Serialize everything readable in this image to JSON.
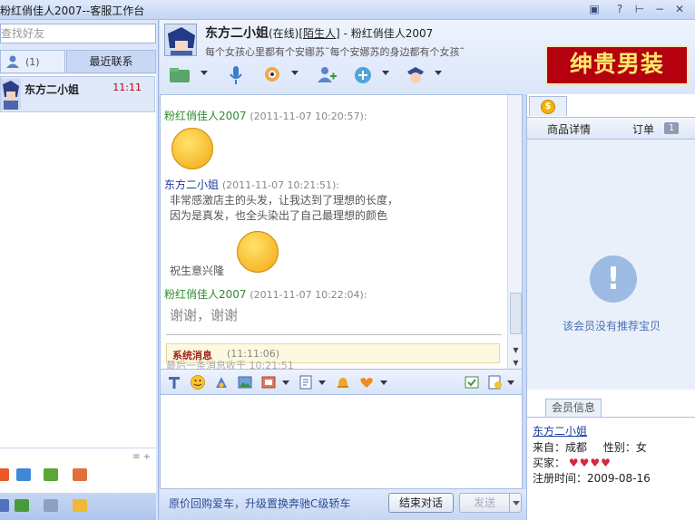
{
  "window": {
    "title": "粉红俏佳人2007--客服工作台",
    "controls": [
      "▣",
      "?",
      "⊢",
      "−",
      "✕"
    ]
  },
  "sidebar": {
    "search_placeholder": "查找好友",
    "contacts_count": "(1)",
    "recent_tab_label": "最近联系",
    "contacts": [
      {
        "name": "东方二小姐",
        "time": "11:11"
      }
    ],
    "list_controls": "≡ +"
  },
  "header": {
    "contact_name": "东方二小姐",
    "status": "(在线)",
    "tag": "[陌生人]",
    "separator": " - ",
    "account": "粉红俏佳人2007",
    "signature": "每个女孩心里都有个安娜苏˜每个安娜苏的身边都有个女孩˜",
    "banner_text": "绅贵男装"
  },
  "chat": {
    "messages": [
      {
        "sender": "粉红俏佳人2007",
        "timestamp": "(2011-11-07 10:20:57):",
        "kind": "emoticon"
      },
      {
        "sender": "东方二小姐",
        "timestamp": "(2011-11-07 10:21:51):",
        "lines": [
          "非常感激店主的头发，让我达到了理想的长度，",
          "因为是真发，也全头染出了自己最理想的颜色"
        ],
        "extra": "祝生意兴隆"
      },
      {
        "sender": "粉红俏佳人2007",
        "timestamp": "(2011-11-07 10:22:04):",
        "big_text": "谢谢，谢谢"
      }
    ],
    "system_label": "系统消息",
    "system_time": "(11:11:06)",
    "last_received": "最后一条消息收于 10:21:51"
  },
  "bottom": {
    "promo": "原价回购爱车，升级置换奔驰C级轿车",
    "end_button": "结束对话",
    "send_button": "发送"
  },
  "right_panel": {
    "coin_symbol": "$",
    "tab_details": "商品详情",
    "tab_orders": "订单",
    "orders_count": "1",
    "no_recommend": "该会员没有推荐宝贝",
    "exclamation": "!",
    "member_tab": "会员信息",
    "member": {
      "name": "东方二小姐",
      "from_label": "来自：",
      "from": "成都",
      "gender_label": "性别：",
      "gender": "女",
      "buyer_label": "买家：",
      "register_label": "注册时间：",
      "register_date": "2009-08-16"
    }
  },
  "colors": {
    "accent": "#2e8b2e",
    "sender_b": "#1c3d9c",
    "banner": "#b4000f",
    "time_red": "#c00000"
  }
}
